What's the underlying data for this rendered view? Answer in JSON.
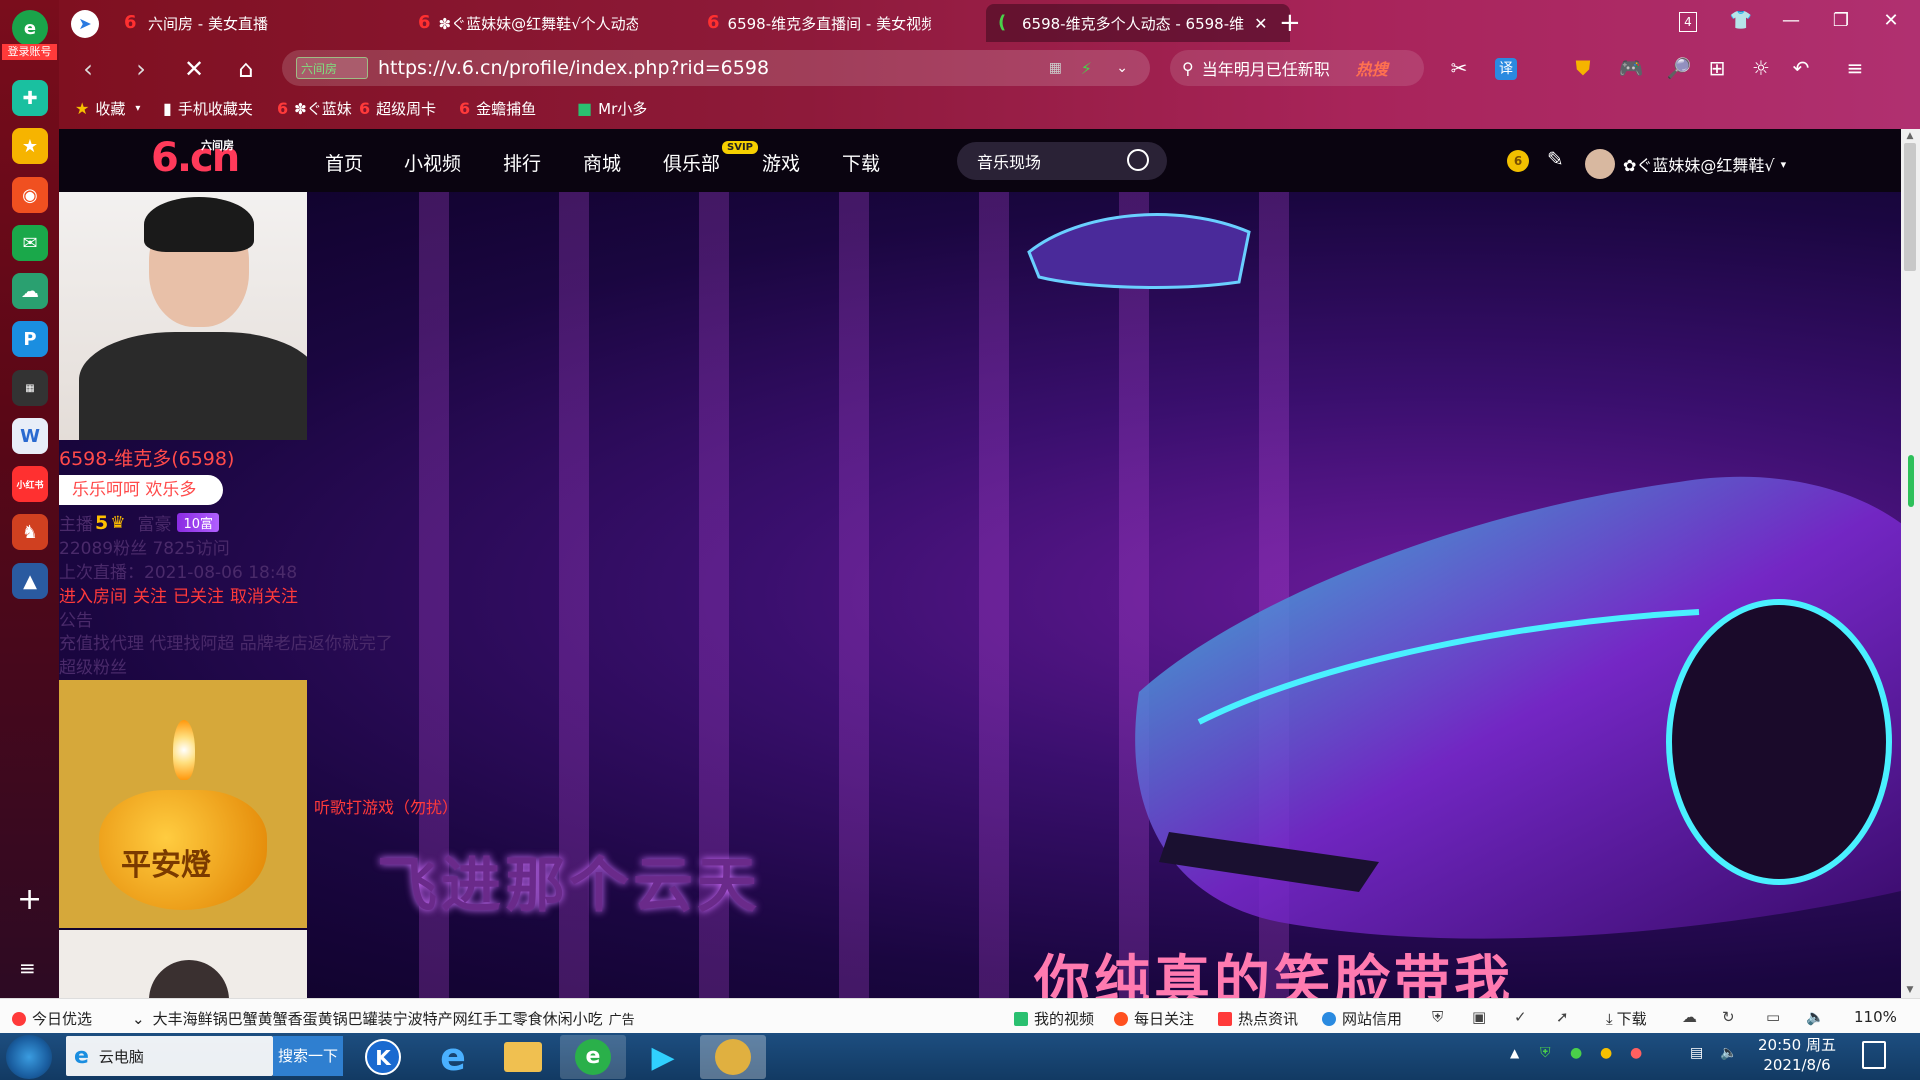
{
  "browser": {
    "sidebar_account_label": "登录账号",
    "tabs": [
      {
        "label": "六间房 - 美女直播"
      },
      {
        "label": "✽ぐ蓝妹妹@红舞鞋√个人动态"
      },
      {
        "label": "6598-维克多直播间 - 美女视频"
      },
      {
        "label": "6598-维克多个人动态 - 6598-维"
      }
    ],
    "tab_count": "4",
    "url_badge": "六间房",
    "url": "https://v.6.cn/profile/index.php?rid=6598",
    "search_text": "当年明月已任新职",
    "search_hot": "热搜",
    "bookmarks": {
      "favorites": "收藏",
      "mobile": "手机收藏夹",
      "b1": "✽ぐ蓝妹",
      "b2": "超级周卡",
      "b3": "金蟾捕鱼",
      "b4": "Mr小多"
    }
  },
  "site": {
    "logo_main": "6.cn",
    "logo_sub": "六间房",
    "nav": [
      "首页",
      "小视频",
      "排行",
      "商城",
      "俱乐部",
      "游戏",
      "下载"
    ],
    "svip": "SVIP",
    "search_placeholder": "音乐现场",
    "coin_label": "6",
    "username": "✿ぐ蓝妹妹@红舞鞋√"
  },
  "profile": {
    "name": "6598-维克多(6598)",
    "motto": "乐乐呵呵 欢乐多",
    "anchor_label": "主播",
    "anchor_level": "5",
    "rich_label": "富豪",
    "rich_badge": "10富",
    "stats": "22089粉丝 7825访问",
    "last_live": "上次直播：2021-08-06 18:48",
    "actions": [
      "进入房间",
      "关注",
      "已关注",
      "取消关注"
    ],
    "notice_title": "公告",
    "notice_text": "充值找代理 代理找阿超 品牌老店返你就完了",
    "superfans": "超级粉丝",
    "lamp_text": "平安燈",
    "song_tag": "听歌打游戏（勿扰）",
    "lyric1": "飞进那个云天",
    "lyric2": "你纯真的笑脸带我"
  },
  "statusbar": {
    "today": "今日优选",
    "ad": "大丰海鲜锅巴蟹黄蟹香蛋黄锅巴罐装宁波特产网红手工零食休闲小吃",
    "ad_tag": "广告",
    "my_video": "我的视频",
    "daily": "每日关注",
    "hot_news": "热点资讯",
    "credit": "网站信用",
    "download": "下载",
    "zoom": "110%"
  },
  "taskbar": {
    "ie_label": "云电脑",
    "search_btn": "搜索一下",
    "time": "20:50 周五",
    "date": "2021/8/6"
  },
  "colors": {
    "accent_red": "#ff3a3a",
    "chrome_red": "#8e1a3a"
  }
}
